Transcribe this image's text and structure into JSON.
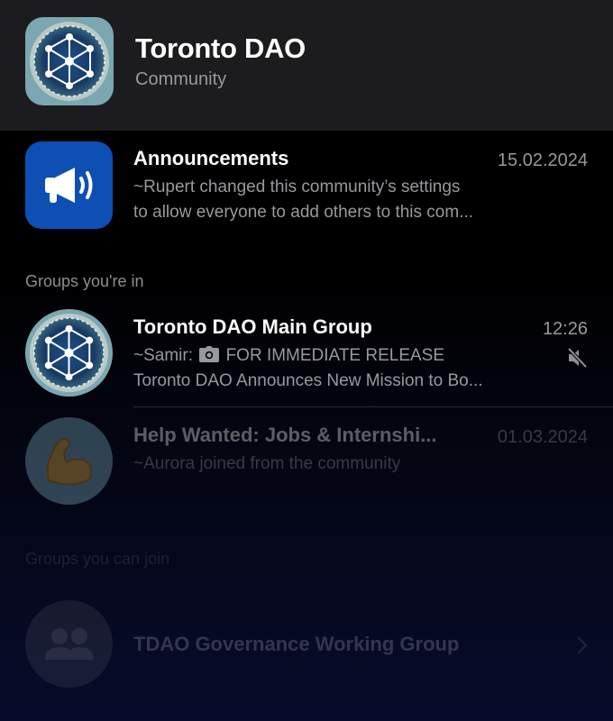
{
  "header": {
    "title": "Toronto DAO",
    "subtitle": "Community",
    "logo_icon": "toronto-dao-logo"
  },
  "announcements": {
    "name": "Announcements",
    "time": "15.02.2024",
    "line1": "~Rupert changed this community’s settings",
    "line2": "to allow everyone to add others to this com...",
    "icon": "megaphone-icon",
    "icon_bg": "#0d4fb3"
  },
  "sections": {
    "groups_in": "Groups you're in",
    "groups_can_join": "Groups you can join"
  },
  "groups": [
    {
      "name": "Toronto DAO Main Group",
      "time": "12:26",
      "sender": "~Samir:",
      "line1_text": "FOR IMMEDIATE RELEASE",
      "line2": "Toronto DAO Announces New Mission to Bo...",
      "icons": [
        "camera-icon",
        "muted-speaker-icon"
      ]
    },
    {
      "name": "Help Wanted: Jobs & Internshi...",
      "time": "01.03.2024",
      "line1": "~Aurora joined from the community",
      "icon": "flexed-biceps-icon"
    }
  ],
  "joinable": [
    {
      "name": "TDAO Governance Working Group",
      "icon": "people-icon"
    }
  ]
}
